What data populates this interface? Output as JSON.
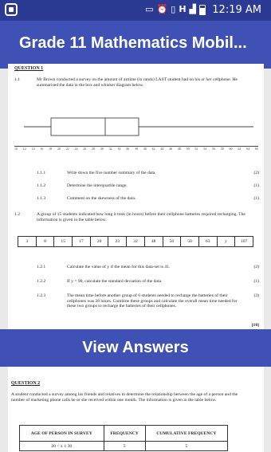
{
  "status_bar": {
    "time": "12:19",
    "time_suffix": "AM",
    "network_label": "H"
  },
  "app_bar": {
    "title": "Grade 11 Mathematics Mobil..."
  },
  "question1": {
    "heading": "QUESTION 1",
    "q1_1": {
      "number": "1.1",
      "text": "Mr Brown conducted a survey on the amount of airtime (in rands) LAST student had on his or her cellphone. He summarised the data in the box and whisker diagram below."
    },
    "scale_ticks": [
      "10",
      "12",
      "14",
      "16",
      "18",
      "20",
      "22",
      "24",
      "26",
      "28",
      "30",
      "32",
      "34",
      "36",
      "38",
      "40",
      "42",
      "44",
      "46",
      "48",
      "50",
      "52",
      "54",
      "56",
      "58",
      "60",
      "62",
      "64",
      "66"
    ],
    "sub_items": [
      {
        "number": "1.1.1",
        "text": "Write down the five number summary of the data.",
        "marks": "(2)"
      },
      {
        "number": "1.1.2",
        "text": "Determine the interquartile range.",
        "marks": "(1)"
      },
      {
        "number": "1.1.3",
        "text": "Comment on the skewness of the data.",
        "marks": "(1)"
      }
    ],
    "q1_2": {
      "number": "1.2",
      "text": "A group of 15 students indicated how long it took (in hours) before their cellphone batteries required recharging. The information is given in the table below."
    },
    "table_values": [
      "3",
      "8",
      "15",
      "17",
      "20",
      "23",
      "32",
      "48",
      "50",
      "50",
      "63",
      "y",
      "107"
    ],
    "sub_items2": [
      {
        "number": "1.2.1",
        "text": "Calculate the value of y if the mean for this data-set is 41.",
        "marks": "(2)"
      },
      {
        "number": "1.2.2",
        "text": "If y = 90, calculate the standard deviation of the data.",
        "marks": "(1)"
      },
      {
        "number": "1.2.3",
        "text": "The mean time before another group of 6 students needed to recharge the batteries of their cellphones was 38 hours. Combine these groups and calculate the overall mean time needed for these two groups to recharge the batteries of their cellphones.",
        "marks": "(3)"
      }
    ],
    "total": "[10]"
  },
  "view_answers": {
    "label": "View Answers"
  },
  "question2": {
    "heading": "QUESTION 2",
    "text": "A student conducted a survey among his friends and relatives to determine the relationship between the age of a person and the number of marketing phone calls he or she received within one month. The information is given in the table below.",
    "table_headers": [
      "AGE OF PERSON IN SURVEY",
      "FREQUENCY",
      "CUMULATIVE FREQUENCY"
    ],
    "table_row1": [
      "20 < x ≤ 30",
      "5",
      "5"
    ]
  }
}
